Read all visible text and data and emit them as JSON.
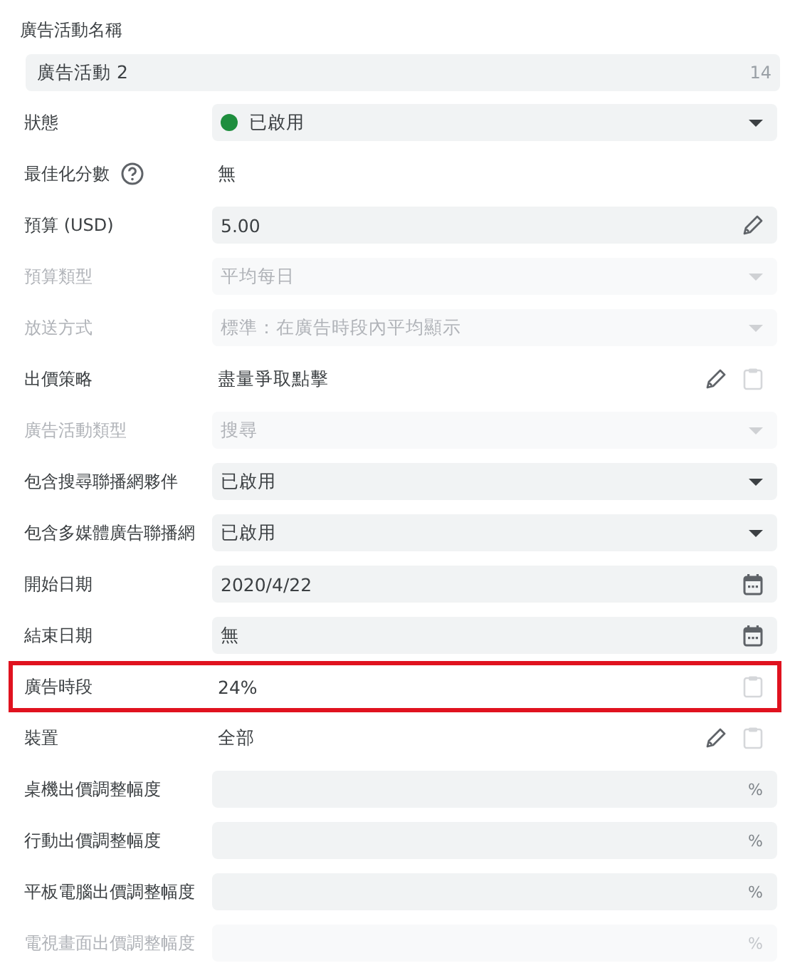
{
  "name_field": {
    "label": "廣告活動名稱",
    "value": "廣告活動 2",
    "counter": "14"
  },
  "rows": [
    {
      "label": "狀態",
      "kind": "select",
      "value": "已啟用",
      "color": "#1e8e3e",
      "disabled": false
    },
    {
      "label": "最佳化分數",
      "kind": "plain",
      "value": "無",
      "help": true
    },
    {
      "label": "預算 (USD)",
      "kind": "edit",
      "value": "5.00",
      "disabled": false
    },
    {
      "label": "預算類型",
      "kind": "select",
      "value": "平均每日",
      "disabled": true
    },
    {
      "label": "放送方式",
      "kind": "select",
      "value": "標準：在廣告時段內平均顯示",
      "disabled": true
    },
    {
      "label": "出價策略",
      "kind": "plain",
      "value": "盡量爭取點擊",
      "editable": true,
      "copyable": true
    },
    {
      "label": "廣告活動類型",
      "kind": "select",
      "value": "搜尋",
      "disabled": true
    },
    {
      "label": "包含搜尋聯播網夥伴",
      "kind": "select",
      "value": "已啟用",
      "disabled": false
    },
    {
      "label": "包含多媒體廣告聯播網",
      "kind": "select",
      "value": "已啟用",
      "disabled": false
    },
    {
      "label": "開始日期",
      "kind": "date",
      "value": "2020/4/22",
      "disabled": false
    },
    {
      "label": "結束日期",
      "kind": "date",
      "value": "無",
      "disabled": false
    },
    {
      "label": "廣告時段",
      "kind": "plain",
      "value": "24%",
      "copyable": true,
      "highlighted": true
    },
    {
      "label": "裝置",
      "kind": "plain",
      "value": "全部",
      "editable": true,
      "copyable": true
    },
    {
      "label": "桌機出價調整幅度",
      "kind": "percent",
      "unit": "%",
      "disabled": false
    },
    {
      "label": "行動出價調整幅度",
      "kind": "percent",
      "unit": "%",
      "disabled": false
    },
    {
      "label": "平板電腦出價調整幅度",
      "kind": "percent",
      "unit": "%",
      "disabled": false
    },
    {
      "label": "電視畫面出價調整幅度",
      "kind": "percent",
      "unit": "%",
      "disabled": true
    }
  ]
}
